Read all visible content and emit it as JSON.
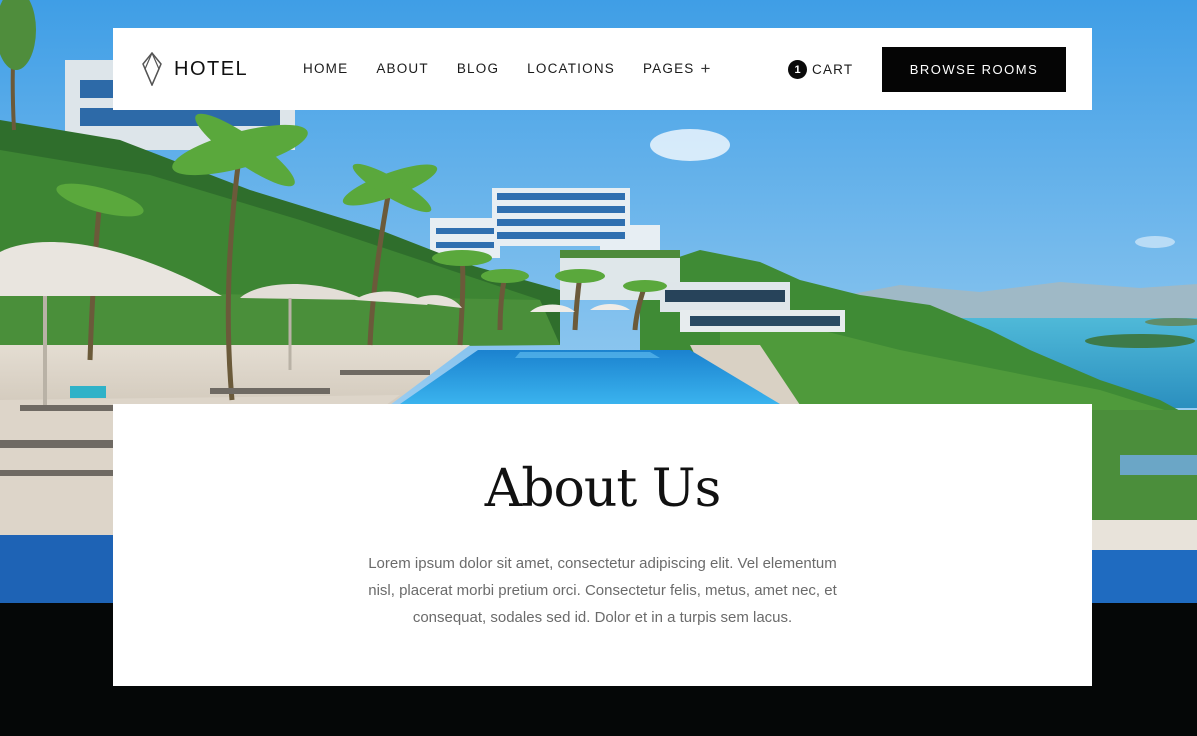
{
  "brand": {
    "name": "HOTEL",
    "logo_icon": "diamond-leaf-icon"
  },
  "nav": {
    "items": [
      {
        "label": "HOME"
      },
      {
        "label": "ABOUT"
      },
      {
        "label": "BLOG"
      },
      {
        "label": "LOCATIONS"
      },
      {
        "label": "PAGES",
        "icon": "plus-icon"
      }
    ]
  },
  "cart": {
    "count": "1",
    "label": "CART"
  },
  "cta": {
    "label": "BROWSE ROOMS"
  },
  "about": {
    "title": "About Us",
    "body": "Lorem ipsum dolor sit amet, consectetur adipiscing elit. Vel elementum nisl, placerat morbi pretium orci. Consectetur felis, metus, amet nec, et consequat, sodales sed id. Dolor et in a turpis sem lacus."
  },
  "colors": {
    "header_bg": "#ffffff",
    "button_bg": "#050505",
    "page_bg": "#050707",
    "sky": "#4aa6e6",
    "pool": "#1c8fd8"
  }
}
